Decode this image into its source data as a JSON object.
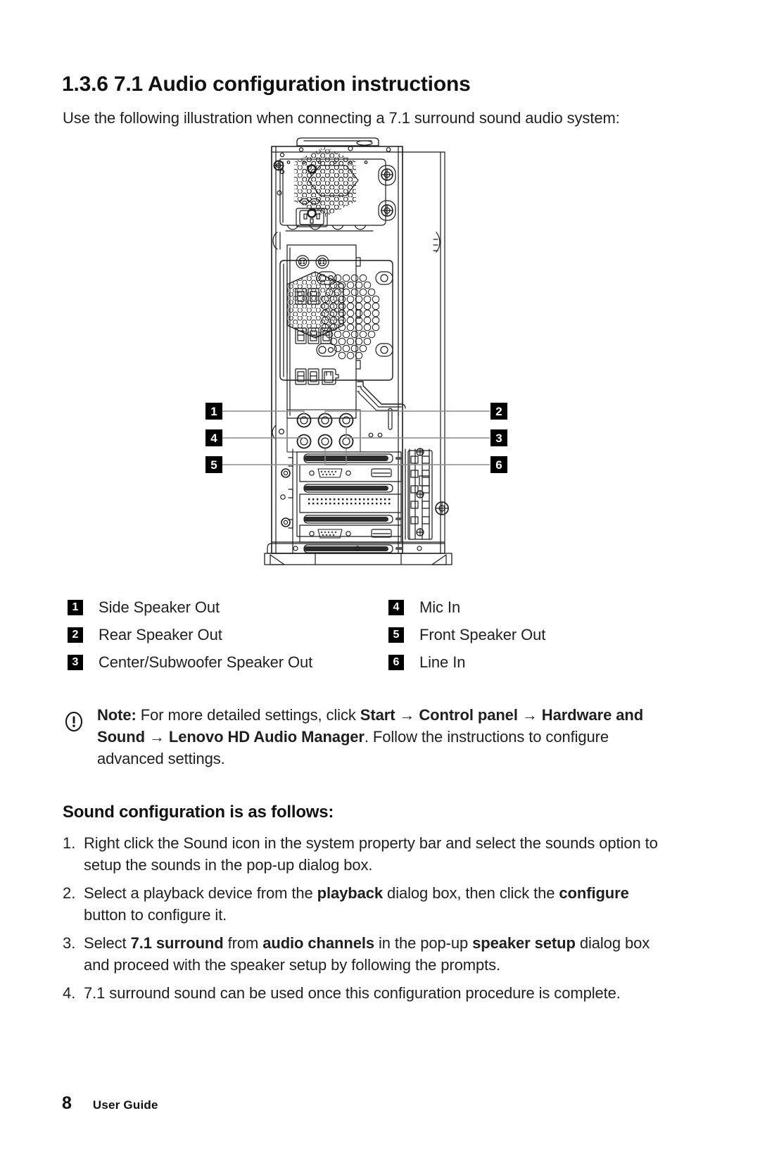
{
  "document": {
    "section_number": "1.3.6",
    "heading": "1.3.6 7.1 Audio configuration instructions",
    "intro": "Use the following illustration when connecting a 7.1 surround sound audio system:"
  },
  "illustration": {
    "name": "computer-rear-panel-diagram",
    "description": "Rear view line drawing of a desktop computer tower showing power supply, fan grille, I/O ports, audio jacks and expansion slots",
    "callouts": [
      {
        "number": "1",
        "side": "left",
        "row": 1
      },
      {
        "number": "4",
        "side": "left",
        "row": 2
      },
      {
        "number": "5",
        "side": "left",
        "row": 3
      },
      {
        "number": "2",
        "side": "right",
        "row": 1
      },
      {
        "number": "3",
        "side": "right",
        "row": 2
      },
      {
        "number": "6",
        "side": "right",
        "row": 3
      }
    ]
  },
  "legend": {
    "left_column": [
      {
        "number": "1",
        "label": "Side Speaker Out"
      },
      {
        "number": "2",
        "label": "Rear Speaker Out"
      },
      {
        "number": "3",
        "label": "Center/Subwoofer Speaker Out"
      }
    ],
    "right_column": [
      {
        "number": "4",
        "label": "Mic In"
      },
      {
        "number": "5",
        "label": "Front Speaker Out"
      },
      {
        "number": "6",
        "label": "Line In"
      }
    ]
  },
  "note": {
    "icon": "exclamation-circle-icon",
    "label": "Note:",
    "text_part_1": " For more detailed settings, click ",
    "bold_1": "Start",
    "arrow_1": " → ",
    "bold_2": "Control panel",
    "arrow_2": " → ",
    "bold_3": "Hardware and Sound",
    "arrow_3": " → ",
    "bold_4": "Lenovo HD Audio Manager",
    "text_part_2": ". Follow the instructions to configure advanced settings."
  },
  "sound_config": {
    "heading": "Sound configuration is as follows:",
    "steps": [
      {
        "number": "1.",
        "segments": [
          {
            "text": "Right click the Sound icon in the system property bar and select the sounds option to setup the sounds in the pop-up dialog box.",
            "bold": false
          }
        ]
      },
      {
        "number": "2.",
        "segments": [
          {
            "text": "Select a playback device from the ",
            "bold": false
          },
          {
            "text": "playback",
            "bold": true
          },
          {
            "text": " dialog box, then click the ",
            "bold": false
          },
          {
            "text": "configure",
            "bold": true
          },
          {
            "text": " button to configure it.",
            "bold": false
          }
        ]
      },
      {
        "number": "3.",
        "segments": [
          {
            "text": "Select ",
            "bold": false
          },
          {
            "text": "7.1 surround",
            "bold": true
          },
          {
            "text": " from ",
            "bold": false
          },
          {
            "text": "audio channels",
            "bold": true
          },
          {
            "text": " in the pop-up ",
            "bold": false
          },
          {
            "text": "speaker setup",
            "bold": true
          },
          {
            "text": " dialog box and proceed with the speaker setup by following the prompts.",
            "bold": false
          }
        ]
      },
      {
        "number": "4.",
        "segments": [
          {
            "text": "7.1 surround sound can be used once this configuration procedure is complete.",
            "bold": false
          }
        ]
      }
    ]
  },
  "footer": {
    "page_number": "8",
    "label": "User Guide"
  },
  "colors": {
    "text": "#1f1f1f",
    "heading": "#111111",
    "badge_bg": "#000000",
    "badge_fg": "#ffffff",
    "page_bg": "#ffffff",
    "line_art": "#1a1a1a",
    "callout_leader": "#808080"
  }
}
